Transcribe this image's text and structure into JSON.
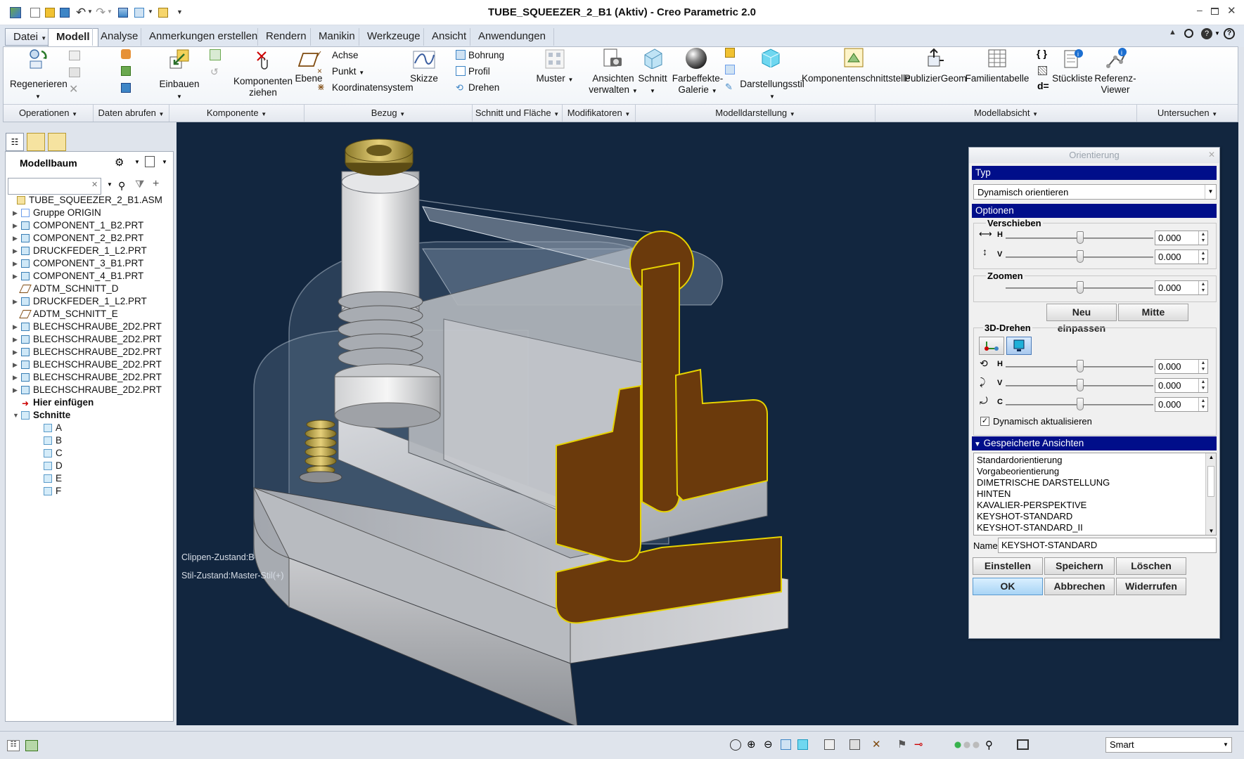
{
  "window": {
    "title": "TUBE_SQUEEZER_2_B1 (Aktiv) - Creo Parametric 2.0"
  },
  "menu_tabs": [
    "Datei",
    "Modell",
    "Analyse",
    "Anmerkungen erstellen",
    "Rendern",
    "Manikin",
    "Werkzeuge",
    "Ansicht",
    "Anwendungen"
  ],
  "ribbon": {
    "regenerieren": "Regenerieren",
    "einbauen": "Einbauen",
    "komponenten_ziehen_1": "Komponenten",
    "komponenten_ziehen_2": "ziehen",
    "ebene": "Ebene",
    "achse": "Achse",
    "punkt": "Punkt",
    "koordinatensystem": "Koordinatensystem",
    "skizze": "Skizze",
    "bohrung": "Bohrung",
    "profil": "Profil",
    "drehen": "Drehen",
    "muster": "Muster",
    "ansichten_1": "Ansichten",
    "ansichten_2": "verwalten",
    "schnitt": "Schnitt",
    "farbeffekte_1": "Farbeffekte-",
    "farbeffekte_2": "Galerie",
    "darstellungsstil": "Darstellungsstil",
    "komponentenschnittstelle": "Komponentenschnittstelle",
    "publiziergeom": "PublizierGeom",
    "familientabelle": "Familientabelle",
    "stueckliste": "Stückliste",
    "referenz_1": "Referenz-",
    "referenz_2": "Viewer"
  },
  "groups": [
    "Operationen",
    "Daten abrufen",
    "Komponente",
    "Bezug",
    "Schnitt und Fläche",
    "Modifikatoren",
    "Modelldarstellung",
    "Modellabsicht",
    "Untersuchen"
  ],
  "tree": {
    "title": "Modellbaum",
    "items": [
      {
        "label": "TUBE_SQUEEZER_2_B1.ASM",
        "type": "asm"
      },
      {
        "label": "Gruppe ORIGIN",
        "type": "group"
      },
      {
        "label": "COMPONENT_1_B2.PRT",
        "type": "prt"
      },
      {
        "label": "COMPONENT_2_B2.PRT",
        "type": "prt"
      },
      {
        "label": "DRUCKFEDER_1_L2.PRT",
        "type": "prt"
      },
      {
        "label": "COMPONENT_3_B1.PRT",
        "type": "prt"
      },
      {
        "label": "COMPONENT_4_B1.PRT",
        "type": "prt"
      },
      {
        "label": "ADTM_SCHNITT_D",
        "type": "datum"
      },
      {
        "label": "DRUCKFEDER_1_L2.PRT",
        "type": "prt"
      },
      {
        "label": "ADTM_SCHNITT_E",
        "type": "datum"
      },
      {
        "label": "BLECHSCHRAUBE_2D2.PRT",
        "type": "prt"
      },
      {
        "label": "BLECHSCHRAUBE_2D2.PRT",
        "type": "prt"
      },
      {
        "label": "BLECHSCHRAUBE_2D2.PRT",
        "type": "prt"
      },
      {
        "label": "BLECHSCHRAUBE_2D2.PRT",
        "type": "prt"
      },
      {
        "label": "BLECHSCHRAUBE_2D2.PRT",
        "type": "prt"
      },
      {
        "label": "BLECHSCHRAUBE_2D2.PRT",
        "type": "prt"
      },
      {
        "label": "Hier einfügen",
        "type": "insert"
      },
      {
        "label": "Schnitte",
        "type": "folder"
      },
      {
        "label": "A",
        "type": "section"
      },
      {
        "label": "B",
        "type": "section"
      },
      {
        "label": "C",
        "type": "section"
      },
      {
        "label": "D",
        "type": "section"
      },
      {
        "label": "E",
        "type": "section"
      },
      {
        "label": "F",
        "type": "section"
      }
    ]
  },
  "viewport": {
    "clip_state": "Clippen-Zustand:B",
    "style_state": "Stil-Zustand:Master-Stil(+)"
  },
  "dialog": {
    "title": "Orientierung",
    "typ_header": "Typ",
    "typ_value": "Dynamisch orientieren",
    "optionen_header": "Optionen",
    "verschieben": "Verschieben",
    "h_label": "H",
    "v_label": "V",
    "c_label": "C",
    "zoomen": "Zoomen",
    "neu_einpassen": "Neu einpassen",
    "mitte": "Mitte",
    "drehen3d": "3D-Drehen",
    "value_pan_h": "0.000",
    "value_pan_v": "0.000",
    "value_zoom": "0.000",
    "value_rot_h": "0.000",
    "value_rot_v": "0.000",
    "value_rot_c": "0.000",
    "dynamisch_aktualisieren": "Dynamisch aktualisieren",
    "gespeicherte_header": "Gespeicherte Ansichten",
    "saved_views": [
      "Standardorientierung",
      "Vorgabeorientierung",
      "DIMETRISCHE DARSTELLUNG",
      "HINTEN",
      "KAVALIER-PERSPEKTIVE",
      "KEYSHOT-STANDARD",
      "KEYSHOT-STANDARD_II"
    ],
    "name_label": "Name",
    "name_value": "KEYSHOT-STANDARD",
    "einstellen": "Einstellen",
    "speichern": "Speichern",
    "loeschen": "Löschen",
    "ok": "OK",
    "abbrechen": "Abbrechen",
    "widerrufen": "Widerrufen"
  },
  "statusbar": {
    "filter_value": "Smart"
  },
  "colors": {
    "viewport_bg": "#12263f",
    "section_fill": "#6b3a0c",
    "section_edge": "#e6d200",
    "dialog_header": "#000e8a"
  }
}
